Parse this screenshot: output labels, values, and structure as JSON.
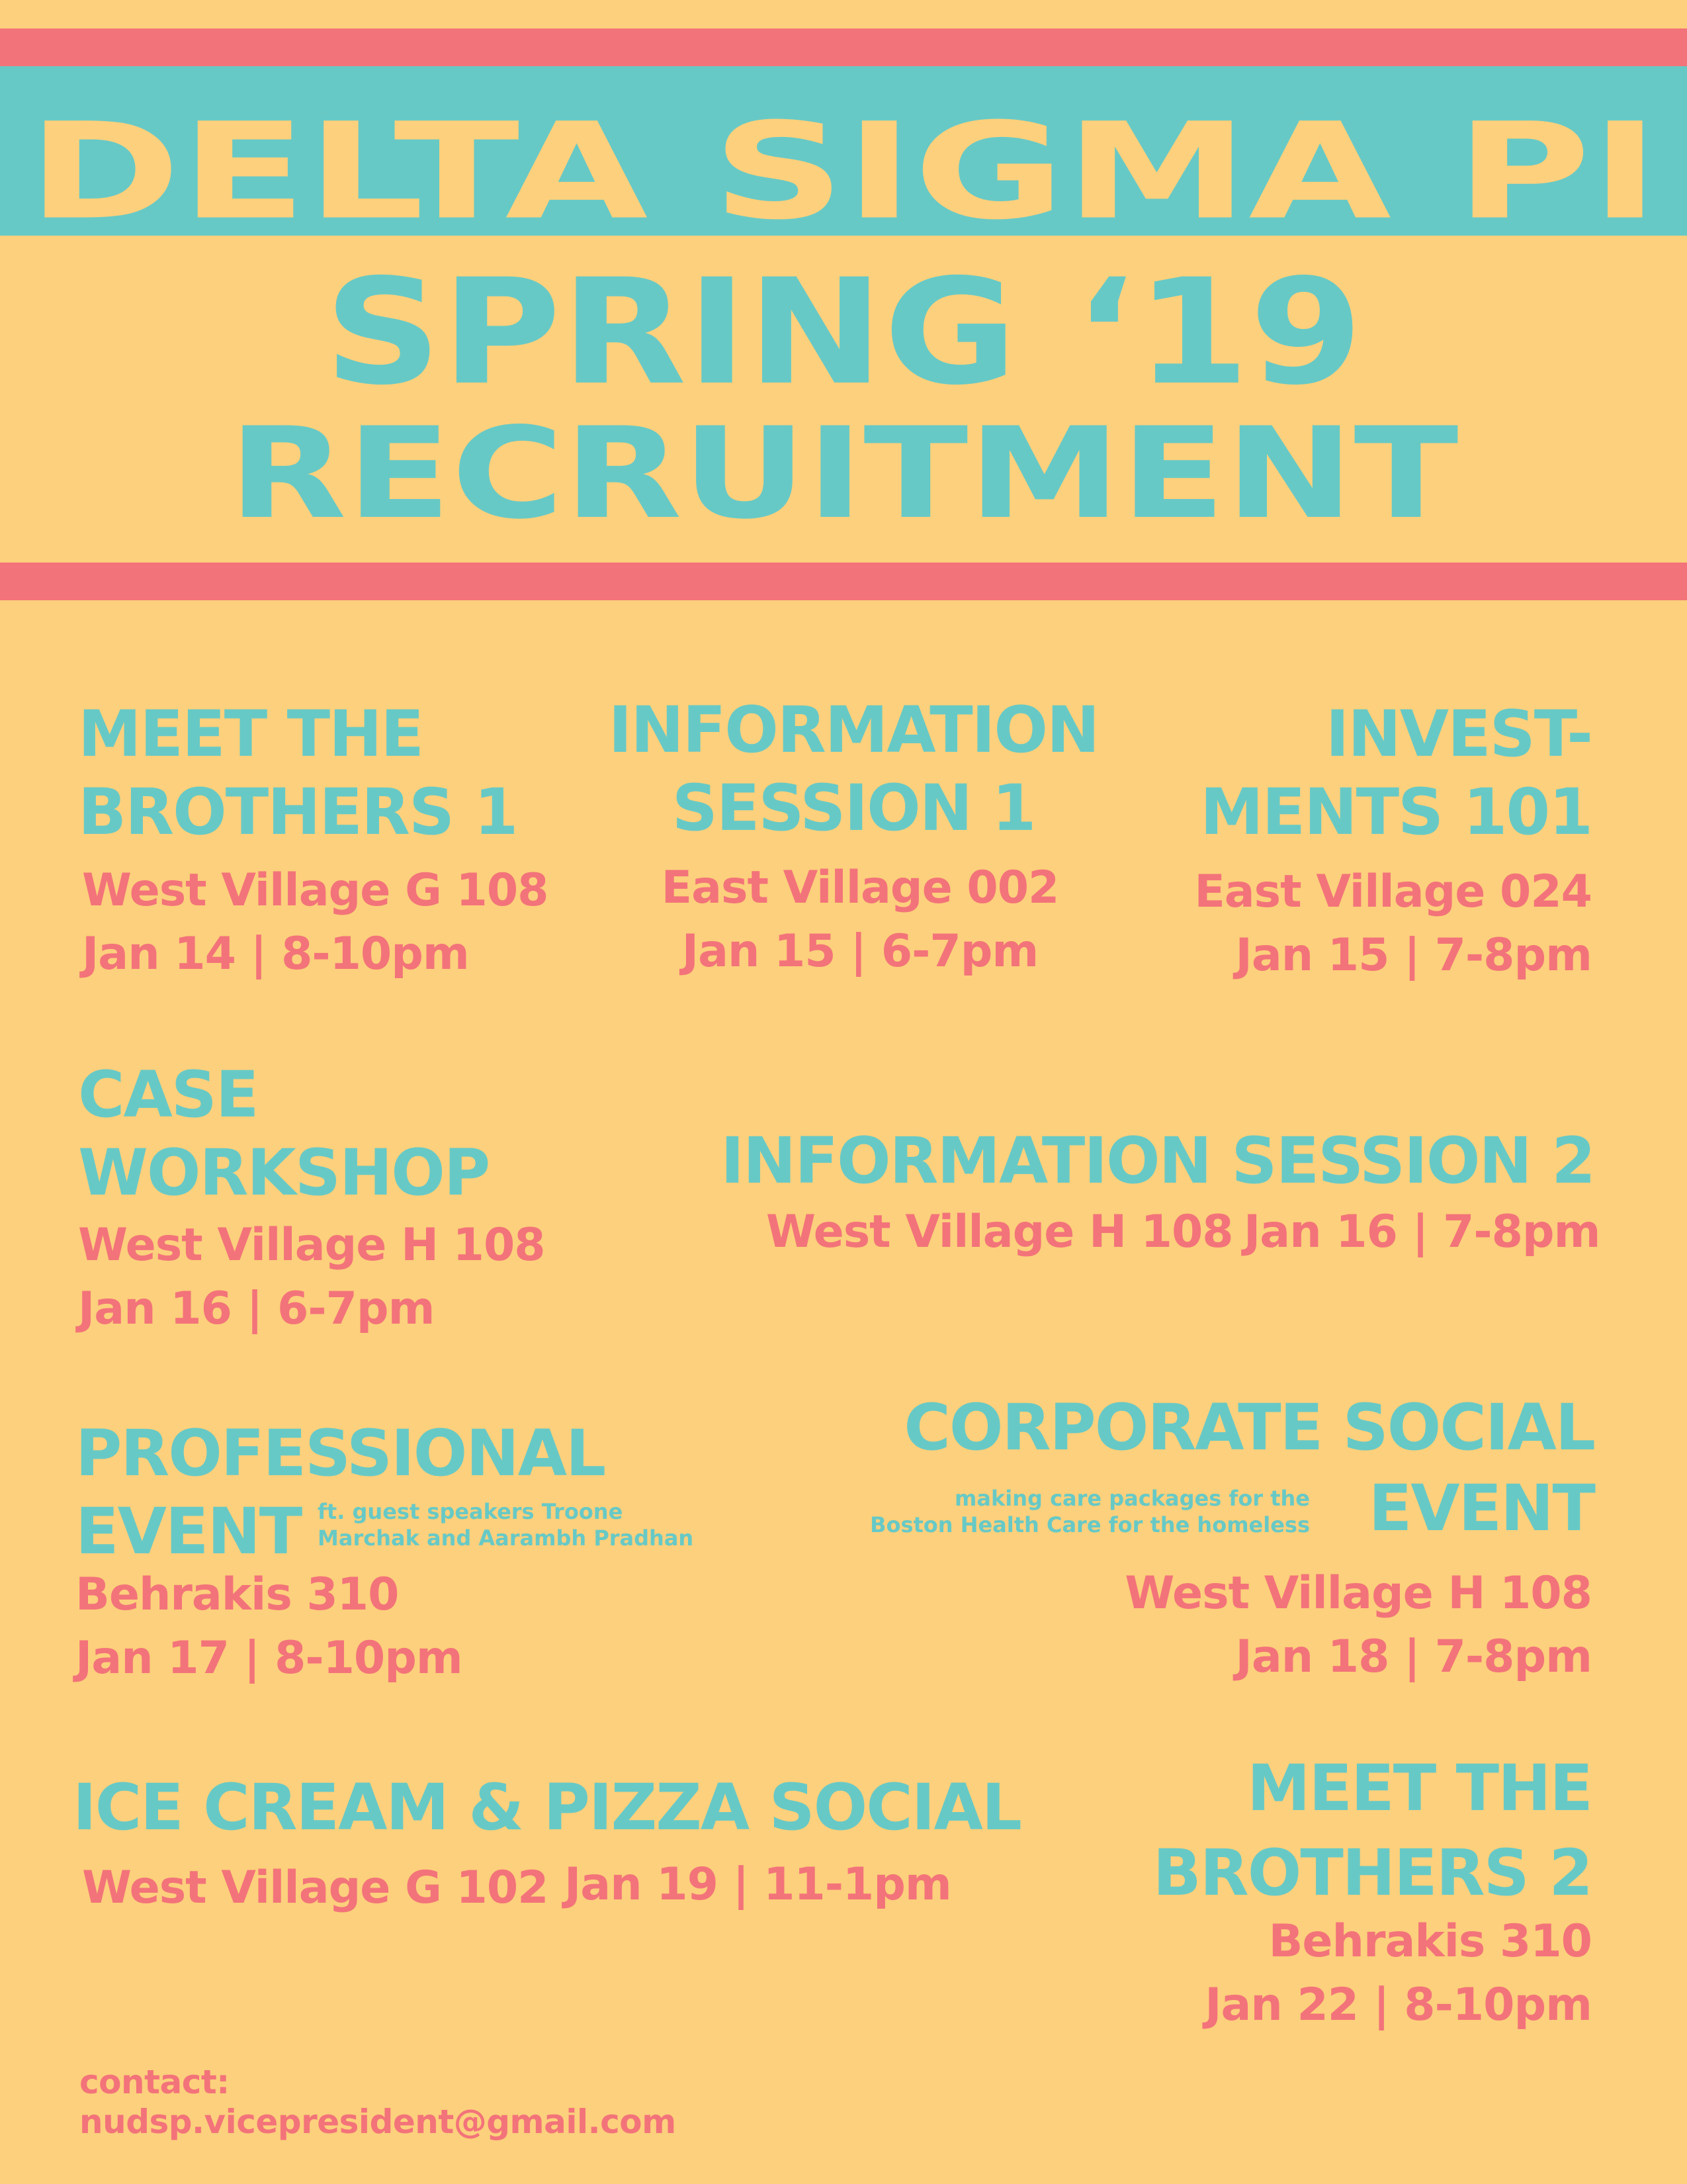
{
  "header": {
    "org": "DELTA SIGMA PI",
    "season": "SPRING ‘19",
    "subtitle": "RECRUITMENT"
  },
  "colors": {
    "background": "#fcd07c",
    "teal": "#67c9c6",
    "coral": "#f3737a"
  },
  "events": {
    "meet1": {
      "title1": "MEET THE",
      "title2": "BROTHERS 1",
      "location": "West Village G 108",
      "when": "Jan 14 | 8-10pm"
    },
    "info1": {
      "title1": "INFORMATION",
      "title2": "SESSION 1",
      "location": "East Village 002",
      "when": "Jan 15 | 6-7pm"
    },
    "invest": {
      "title1": "INVEST-",
      "title2": "MENTS 101",
      "location": "East Village 024",
      "when": "Jan 15 | 7-8pm"
    },
    "case": {
      "title1": "CASE",
      "title2": "WORKSHOP",
      "location": "West Village H 108",
      "when": "Jan 16 | 6-7pm"
    },
    "info2": {
      "title": "INFORMATION SESSION 2",
      "location": "West Village H 108",
      "when": "Jan 16 | 7-8pm"
    },
    "professional": {
      "title1": "PROFESSIONAL",
      "title2": "EVENT",
      "note1": "ft. guest speakers Troone",
      "note2": "Marchak and Aarambh Pradhan",
      "location": "Behrakis 310",
      "when": "Jan 17 | 8-10pm"
    },
    "corporate": {
      "title1": "CORPORATE SOCIAL",
      "title2": "EVENT",
      "note1": "making care packages for the",
      "note2": "Boston Health Care for the homeless",
      "location": "West Village H 108",
      "when": "Jan 18 | 7-8pm"
    },
    "icecream": {
      "title": "ICE CREAM & PIZZA SOCIAL",
      "location": "West Village G 102",
      "when": "Jan 19 | 11-1pm"
    },
    "meet2": {
      "title1": "MEET THE",
      "title2": "BROTHERS 2",
      "location": "Behrakis 310",
      "when": "Jan 22 | 8-10pm"
    }
  },
  "contact": {
    "label": "contact:",
    "email": "nudsp.vicepresident@gmail.com"
  }
}
